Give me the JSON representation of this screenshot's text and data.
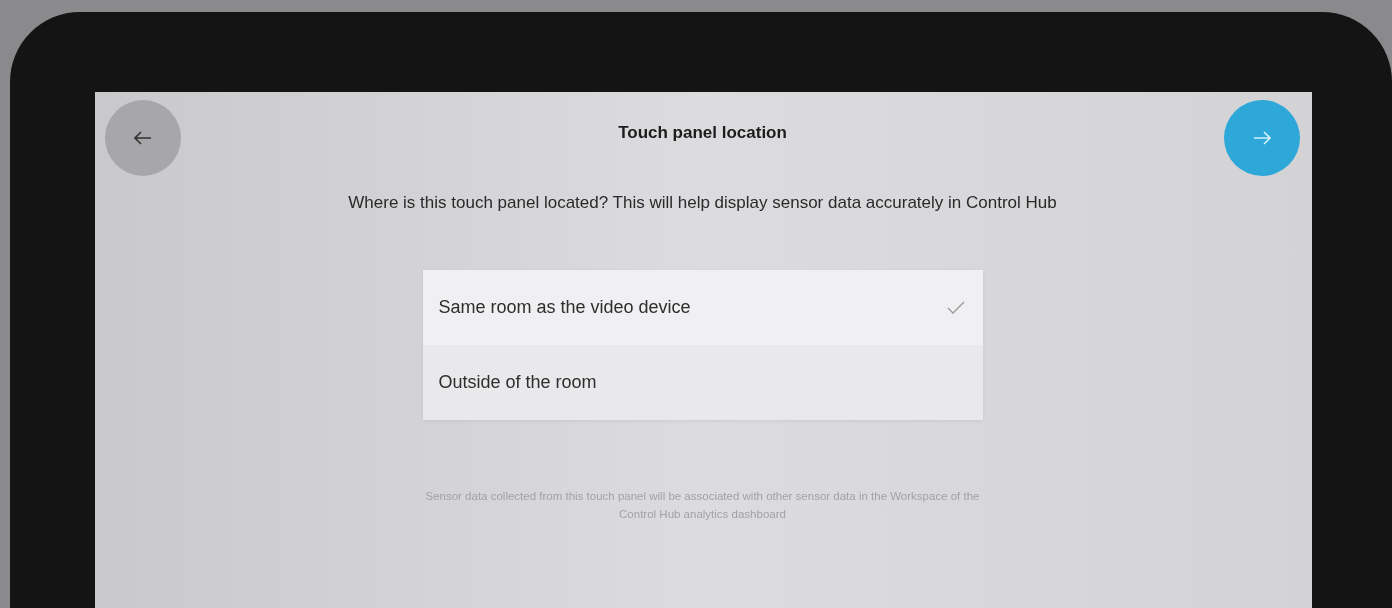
{
  "header": {
    "title": "Touch panel location"
  },
  "question": "Where is this touch panel located? This will help display sensor data accurately in Control Hub",
  "options": [
    {
      "label": "Same room as the video device",
      "selected": true
    },
    {
      "label": "Outside of the room",
      "selected": false
    }
  ],
  "note": "Sensor data collected from this touch panel will be associated with other sensor data in the Workspace of the Control Hub analytics dashboard"
}
